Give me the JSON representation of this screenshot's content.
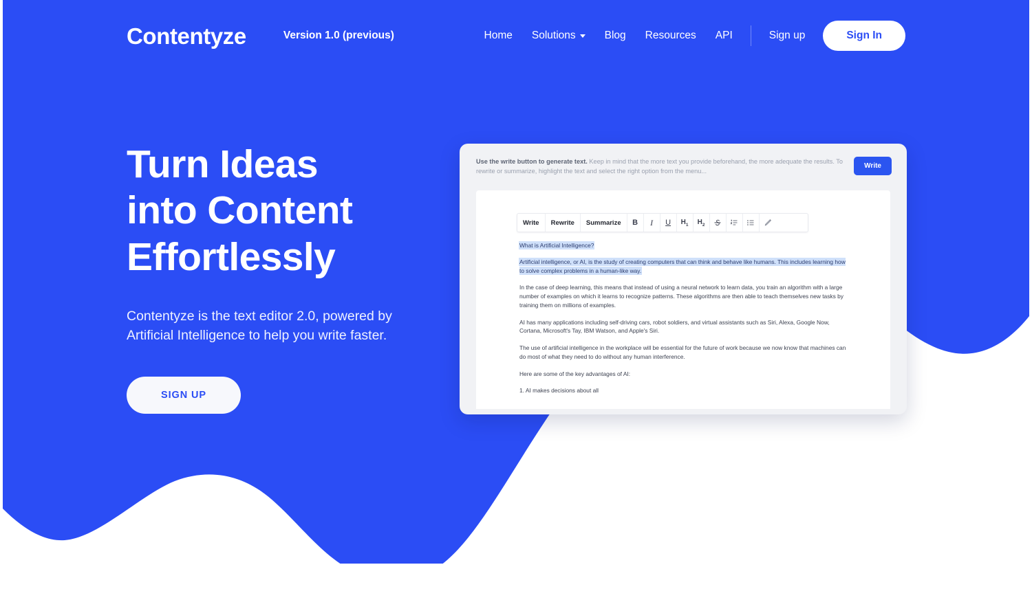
{
  "theme": {
    "brand_blue": "#2b4df5",
    "wave_blue": "#2b4df5",
    "button_white": "#ffffff",
    "highlight_blue": "#cfe0fa"
  },
  "navbar": {
    "brand": "Contentyze",
    "version": "Version 1.0 (previous)",
    "links": [
      {
        "label": "Home"
      },
      {
        "label": "Solutions",
        "has_caret": true
      },
      {
        "label": "Blog"
      },
      {
        "label": "Resources"
      },
      {
        "label": "API"
      }
    ],
    "signup_label": "Sign up",
    "signin_label": "Sign In"
  },
  "hero": {
    "title_lines": [
      "Turn Ideas",
      "into Content",
      "Effortlessly"
    ],
    "subtitle_lines": [
      "Contentyze is the text editor 2.0, powered by",
      "Artificial Intelligence to help you write faster."
    ],
    "cta_label": "SIGN UP"
  },
  "mockup": {
    "hint_bold": "Use the write button to generate text.",
    "hint_rest": " Keep in mind that the more text you provide beforehand, the more adequate the results. To rewrite or summarize, highlight the text and select the right option from the menu...",
    "write_button_label": "Write",
    "toolbar": {
      "actions": [
        "Write",
        "Rewrite",
        "Summarize"
      ],
      "icons": [
        {
          "name": "bold-icon",
          "glyph": "B"
        },
        {
          "name": "italic-icon",
          "glyph": "I"
        },
        {
          "name": "underline-icon",
          "glyph": "U"
        },
        {
          "name": "heading-1-icon",
          "glyph": "H1"
        },
        {
          "name": "heading-2-icon",
          "glyph": "H2"
        },
        {
          "name": "strikethrough-icon",
          "glyph": "S"
        },
        {
          "name": "ordered-list-icon",
          "glyph": "list-ol"
        },
        {
          "name": "unordered-list-icon",
          "glyph": "list-ul"
        },
        {
          "name": "pencil-icon",
          "glyph": "pencil"
        }
      ]
    },
    "document": {
      "heading": "What is Artificial Intelligence?",
      "highlighted_paragraph": "Artificial intelligence, or AI, is the study of creating computers that can think and behave like humans. This includes learning how to solve complex problems in a human-like way.",
      "paragraphs": [
        "In the case of deep learning, this means that instead of using a neural network to learn data, you train an algorithm with a large number of examples on which it learns to recognize patterns. These algorithms are then able to teach themselves new tasks by training them on millions of examples.",
        "AI has many applications including self-driving cars, robot soldiers, and virtual assistants such as Siri, Alexa, Google Now, Cortana, Microsoft's Tay, IBM Watson, and Apple's Siri.",
        "The use of artificial intelligence in the workplace will be essential for the future of work because we now know that machines can do most of what they need to do without any human interference.",
        "Here are some of the key advantages of AI:",
        "1. AI makes decisions about all"
      ]
    }
  }
}
